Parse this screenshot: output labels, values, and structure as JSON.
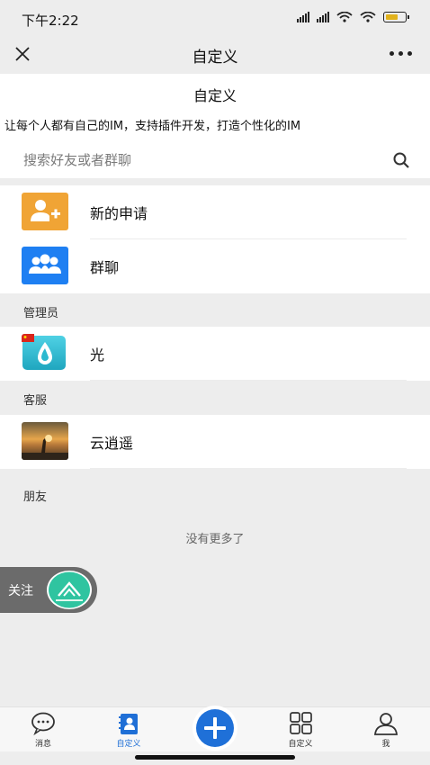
{
  "status": {
    "time": "下午2:22",
    "battery": "68"
  },
  "titlebar": {
    "title": "自定义"
  },
  "header": {
    "title": "自定义",
    "marquee": "交圈，让每个人都有自己的IM，支持插件开发，打造个性化的IM",
    "search_placeholder": "搜索好友或者群聊"
  },
  "top_items": [
    {
      "label": "新的申请",
      "icon": "add-user-icon",
      "color": "#f0a435"
    },
    {
      "label": "群聊",
      "icon": "group-icon",
      "color": "#1e7ff2"
    }
  ],
  "sections": {
    "admin": {
      "title": "管理员",
      "items": [
        {
          "label": "光",
          "icon": "drop-logo-icon"
        }
      ]
    },
    "service": {
      "title": "客服",
      "items": [
        {
          "label": "云逍遥",
          "icon": "photo-avatar"
        }
      ]
    },
    "friends": {
      "title": "朋友"
    }
  },
  "empty_text": "没有更多了",
  "follow": {
    "label": "关注",
    "logo": "gdcoop-logo"
  },
  "tabs": [
    {
      "label": "消息",
      "icon": "chat-bubble-icon",
      "active": false
    },
    {
      "label": "自定义",
      "icon": "contacts-book-icon",
      "active": true
    },
    {
      "label": "",
      "icon": "plus-icon",
      "active": false
    },
    {
      "label": "自定义",
      "icon": "grid-icon",
      "active": false
    },
    {
      "label": "我",
      "icon": "person-icon",
      "active": false
    }
  ],
  "colors": {
    "accent": "#1f70d8",
    "background": "#ededed"
  }
}
